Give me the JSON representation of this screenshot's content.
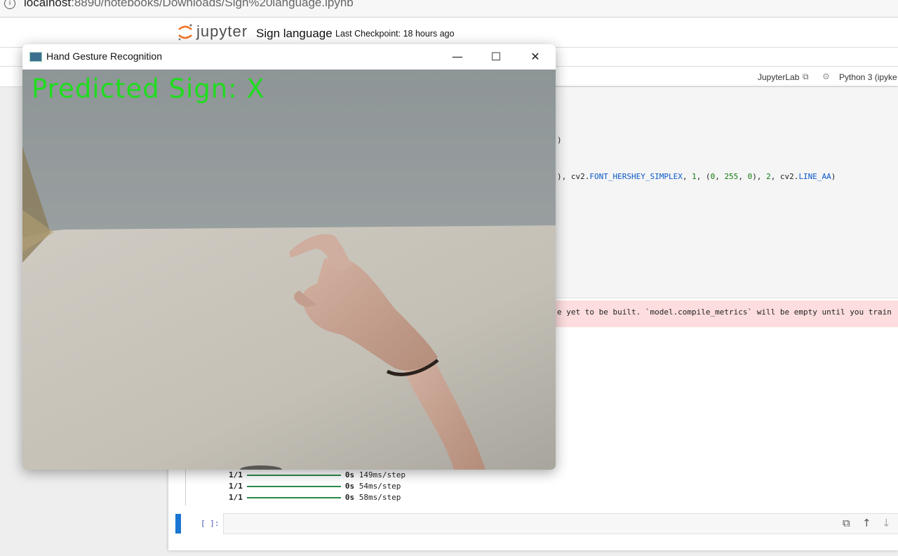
{
  "browser": {
    "url_host": "localhost",
    "url_rest": ":8890/notebooks/Downloads/Sign%20language.ipynb"
  },
  "jupyter": {
    "logo_text": "jupyter",
    "notebook_title": "Sign language",
    "checkpoint": "Last Checkpoint: 18 hours ago",
    "jupyterlab_link": "JupyterLab",
    "kernel": "Python 3 (ipyke"
  },
  "code": {
    "fragment1": ")",
    "fragment2_a": "), cv2.",
    "fragment2_b": "FONT_HERSHEY_SIMPLEX",
    "fragment2_c": ", ",
    "fragment2_d": "1",
    "fragment2_e": ", (",
    "fragment2_f": "0",
    "fragment2_g": ", ",
    "fragment2_h": "255",
    "fragment2_i": ", ",
    "fragment2_j": "0",
    "fragment2_k": "), ",
    "fragment2_l": "2",
    "fragment2_m": ", cv2.",
    "fragment2_n": "LINE_AA",
    "fragment2_o": ")"
  },
  "stderr": {
    "text": "e yet to be built. `model.compile_metrics` will be empty until you train"
  },
  "progress": [
    {
      "step": "1/1",
      "time": "0s",
      "rate": "149ms/step"
    },
    {
      "step": "1/1",
      "time": "0s",
      "rate": "54ms/step"
    },
    {
      "step": "1/1",
      "time": "0s",
      "rate": "58ms/step"
    }
  ],
  "empty_cell": {
    "prompt": "[ ]:"
  },
  "window": {
    "title": "Hand Gesture Recognition",
    "minimize": "—",
    "maximize": "☐",
    "close": "✕",
    "prediction": "Predicted Sign: X"
  },
  "colors": {
    "prediction_text": "#1fdc1f",
    "active_cell": "#1976d2",
    "stderr_bg": "#fddddd"
  },
  "icons": {
    "info": "info-icon",
    "external": "external-link-icon",
    "kernel_status": "kernel-status-icon",
    "copy": "copy-icon",
    "move_up": "arrow-up-icon",
    "move_down": "arrow-down-icon"
  }
}
